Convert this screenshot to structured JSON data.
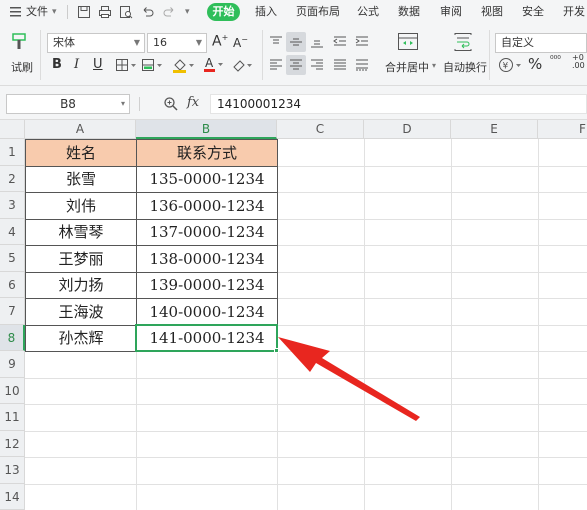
{
  "menu": {
    "file_label": "文件",
    "tabs": [
      "开始",
      "插入",
      "页面布局",
      "公式",
      "数据",
      "审阅",
      "视图",
      "安全",
      "开发"
    ]
  },
  "toolbar": {
    "format_painter_label": "试刷",
    "font_name": "宋体",
    "font_size": "16",
    "merge_center_label": "合并居中",
    "wrap_text_label": "自动换行",
    "number_format": "自定义"
  },
  "formula_bar": {
    "cell_ref": "B8",
    "fx_label": "fx",
    "value": "14100001234"
  },
  "sheet": {
    "columns": [
      "A",
      "B",
      "C",
      "D",
      "E",
      "F"
    ],
    "rows": [
      "1",
      "2",
      "3",
      "4",
      "5",
      "6",
      "7",
      "8",
      "9",
      "10",
      "11",
      "12",
      "13",
      "14"
    ],
    "header": {
      "name": "姓名",
      "contact": "联系方式"
    },
    "records": [
      {
        "name": "张雪",
        "phone": "135-0000-1234"
      },
      {
        "name": "刘伟",
        "phone": "136-0000-1234"
      },
      {
        "name": "林雪琴",
        "phone": "137-0000-1234"
      },
      {
        "name": "王梦丽",
        "phone": "138-0000-1234"
      },
      {
        "name": "刘力扬",
        "phone": "139-0000-1234"
      },
      {
        "name": "王海波",
        "phone": "140-0000-1234"
      },
      {
        "name": "孙杰辉",
        "phone": "141-0000-1234"
      }
    ],
    "selected_cell": "B8"
  },
  "colors": {
    "accent": "#2fbe5a",
    "selection": "#2ea55b",
    "header_fill": "#f8cbad",
    "arrow": "#e8261f"
  }
}
